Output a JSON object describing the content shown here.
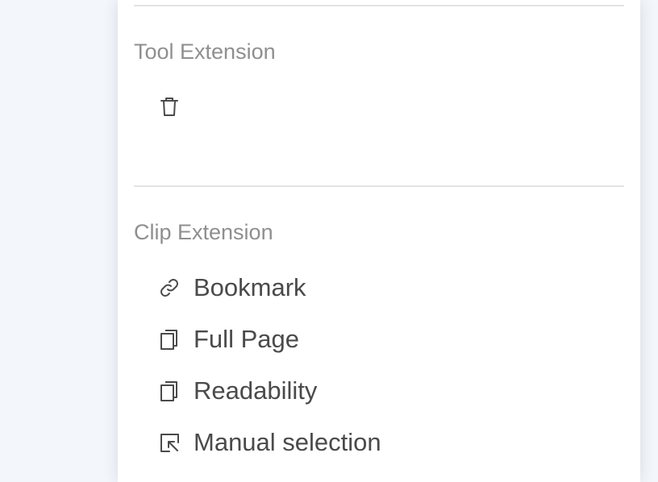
{
  "sections": {
    "tool": {
      "title": "Tool Extension",
      "items": [
        {
          "icon": "trash-icon"
        }
      ]
    },
    "clip": {
      "title": "Clip Extension",
      "items": [
        {
          "label": "Bookmark",
          "icon": "link-icon"
        },
        {
          "label": "Full Page",
          "icon": "copy-icon"
        },
        {
          "label": "Readability",
          "icon": "copy-icon"
        },
        {
          "label": "Manual selection",
          "icon": "select-icon"
        }
      ]
    }
  },
  "colors": {
    "background": "#f3f6fb",
    "panel": "#ffffff",
    "section_title": "#8f8f8f",
    "item_text": "#4a4a4a",
    "icon": "#4a4a4a",
    "divider": "#e3e3e3"
  }
}
